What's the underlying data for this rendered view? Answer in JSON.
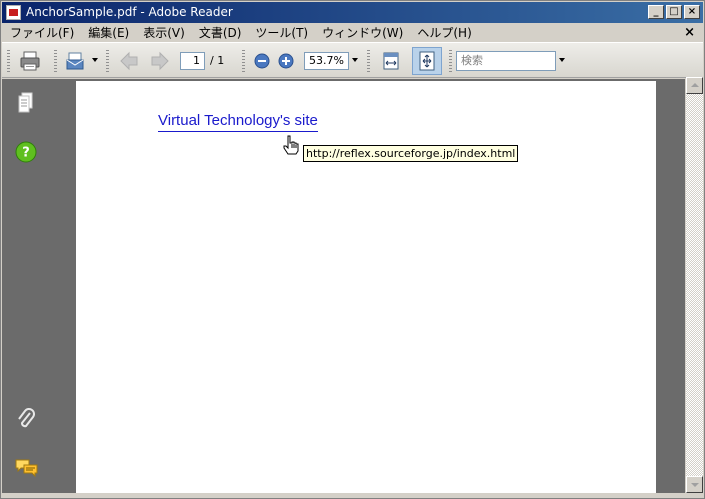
{
  "window": {
    "title": "AnchorSample.pdf - Adobe Reader"
  },
  "titlebar_buttons": {
    "minimize": "_",
    "maximize": "□",
    "close": "×"
  },
  "menu": {
    "items": [
      "ファイル(F)",
      "編集(E)",
      "表示(V)",
      "文書(D)",
      "ツール(T)",
      "ウィンドウ(W)",
      "ヘルプ(H)"
    ],
    "close_doc": "×"
  },
  "toolbar": {
    "page_current": "1",
    "page_total": "/ 1",
    "zoom": "53.7%",
    "search_placeholder": "検索"
  },
  "document": {
    "link_text": "Virtual Technology's site",
    "tooltip": "http://reflex.sourceforge.jp/index.html"
  },
  "icons": {
    "print": "printer-icon",
    "share": "email-icon",
    "prev": "previous-page-icon",
    "next": "next-page-icon",
    "zoom_out": "zoom-out-icon",
    "zoom_in": "zoom-in-icon",
    "fit_width": "fit-width-icon",
    "fit_page": "fit-page-icon",
    "pages": "pages-panel-icon",
    "help": "help-icon",
    "attachments": "attachment-icon",
    "comments": "comments-icon",
    "cursor": "hand-pointer-icon"
  },
  "colors": {
    "titlebar_start": "#0a246a",
    "titlebar_end": "#3a6ea5",
    "link": "#1a1acc",
    "panel_bg": "#6b6b6b",
    "tooltip_bg": "#ffffe1"
  }
}
